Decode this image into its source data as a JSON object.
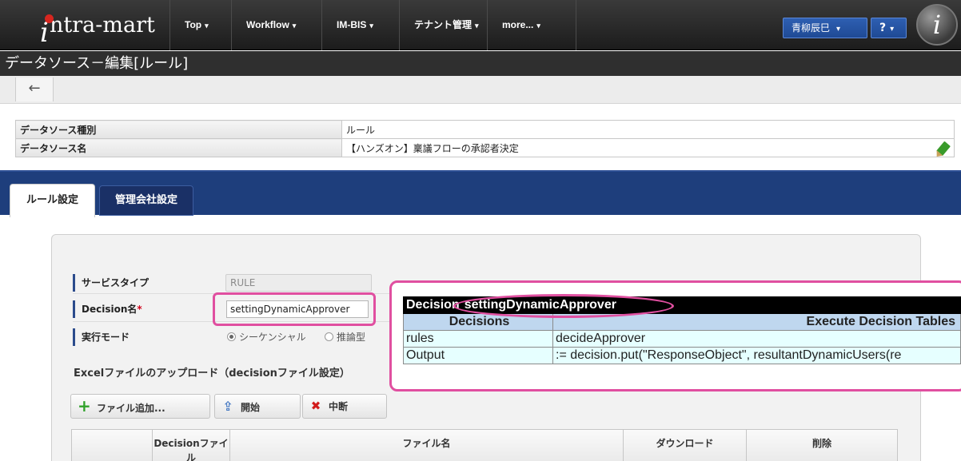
{
  "header": {
    "logo_text": "ntra-mart",
    "logo_mark": "i",
    "nav": [
      {
        "label": "Top"
      },
      {
        "label": "Workflow"
      },
      {
        "label": "IM-BIS"
      },
      {
        "label": "テナント管理"
      },
      {
        "label": "more..."
      }
    ],
    "caret": "▾",
    "user_label": "青柳辰巳",
    "help_label": "?",
    "brand_mark": "i"
  },
  "page_title": "データソース－編集[ルール]",
  "back_icon": "←",
  "info": {
    "rows": [
      {
        "label": "データソース種別",
        "value": "ルール"
      },
      {
        "label": "データソース名",
        "value": "【ハンズオン】稟議フローの承認者決定"
      }
    ]
  },
  "tabs": [
    {
      "label": "ルール設定",
      "active": true
    },
    {
      "label": "管理会社設定",
      "active": false
    }
  ],
  "form": {
    "service_type_label": "サービスタイプ",
    "service_type_value": "RULE",
    "decision_name_label": "Decision名",
    "required_mark": "*",
    "decision_name_value": "settingDynamicApprover",
    "exec_mode_label": "実行モード",
    "exec_modes": [
      {
        "label": "シーケンシャル",
        "selected": true
      },
      {
        "label": "推論型",
        "selected": false
      }
    ],
    "upload_heading": "Excelファイルのアップロード（decisionファイル設定）",
    "buttons": {
      "add_file": "ファイル追加...",
      "start": "開始",
      "stop": "中断"
    },
    "file_table_headers": [
      "",
      "Decisionファイル",
      "ファイル名",
      "ダウンロード",
      "削除"
    ]
  },
  "callout": {
    "title_prefix": "Decision",
    "title_name": "settingDynamicApprover",
    "sub_left": "Decisions",
    "sub_right": "Execute Decision Tables",
    "rows": [
      {
        "key": "rules",
        "value": "decideApprover"
      },
      {
        "key": "Output",
        "value": ":= decision.put(\"ResponseObject\", resultantDynamicUsers(re"
      }
    ]
  },
  "colors": {
    "accent_magenta": "#e04fa0",
    "tab_bar": "#1e3e7c",
    "highlight_yellow": "#fff200"
  }
}
